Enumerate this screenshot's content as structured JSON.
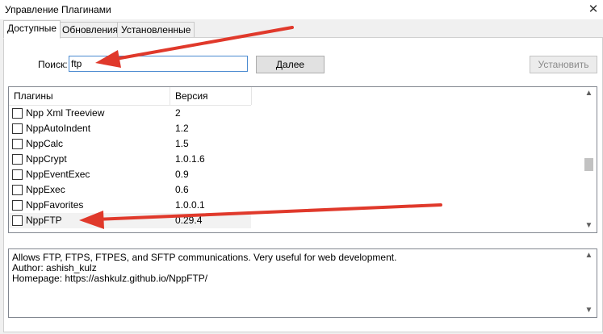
{
  "window": {
    "title": "Управление Плагинами",
    "close_glyph": "✕"
  },
  "tabs": [
    {
      "label": "Доступные",
      "active": true
    },
    {
      "label": "Обновления",
      "active": false
    },
    {
      "label": "Установленные",
      "active": false
    }
  ],
  "search": {
    "label": "Поиск:",
    "value": "ftp"
  },
  "buttons": {
    "next": "Далее",
    "install": "Установить"
  },
  "list": {
    "columns": [
      "Плагины",
      "Версия"
    ],
    "rows": [
      {
        "name": "Npp Xml Treeview",
        "version": "2"
      },
      {
        "name": "NppAutoIndent",
        "version": "1.2"
      },
      {
        "name": "NppCalc",
        "version": "1.5"
      },
      {
        "name": "NppCrypt",
        "version": "1.0.1.6"
      },
      {
        "name": "NppEventExec",
        "version": "0.9"
      },
      {
        "name": "NppExec",
        "version": "0.6"
      },
      {
        "name": "NppFavorites",
        "version": "1.0.0.1"
      },
      {
        "name": "NppFTP",
        "version": "0.29.4"
      }
    ],
    "selected": "NppFTP"
  },
  "description": {
    "lines": [
      "Allows FTP, FTPS, FTPES, and SFTP communications. Very useful for web development.",
      "Author: ashish_kulz",
      "Homepage: https://ashkulz.github.io/NppFTP/"
    ]
  },
  "colors": {
    "annotation_arrow": "#e0392b",
    "input_border": "#4b8bd0"
  }
}
